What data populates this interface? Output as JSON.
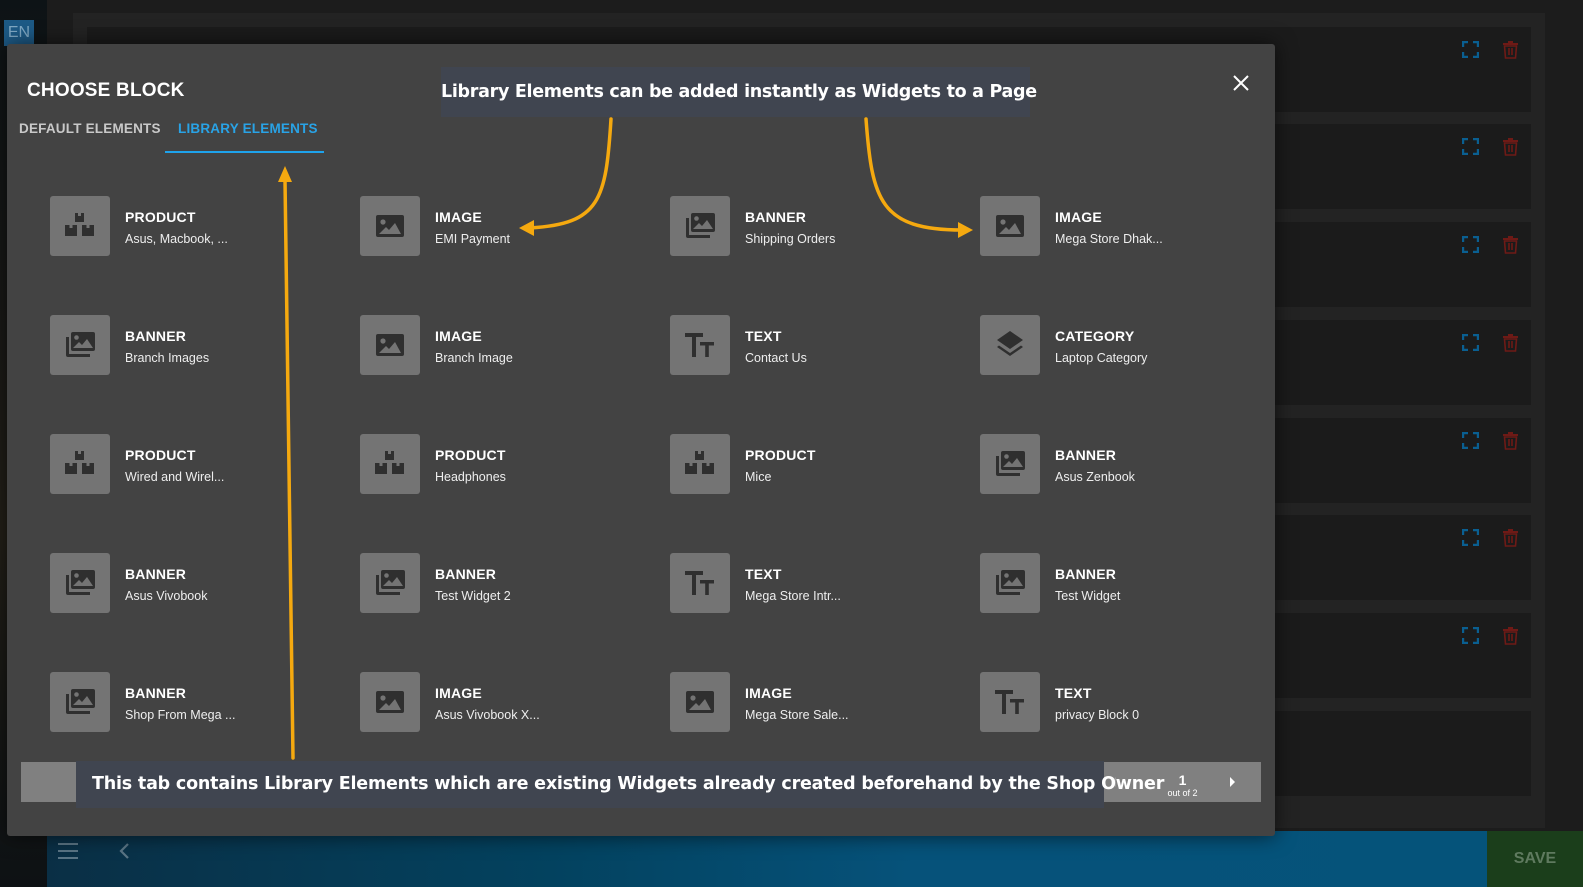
{
  "background": {
    "language_badge": "EN",
    "save_label": "SAVE",
    "row_count": 8
  },
  "modal": {
    "title": "CHOOSE BLOCK",
    "close_icon": "close-icon",
    "tabs": [
      {
        "label": "DEFAULT ELEMENTS",
        "active": false
      },
      {
        "label": "LIBRARY ELEMENTS",
        "active": true
      }
    ],
    "items": [
      {
        "type": "PRODUCT",
        "name": "Asus, Macbook, ...",
        "icon": "boxes-icon"
      },
      {
        "type": "IMAGE",
        "name": "EMI Payment",
        "icon": "image-icon"
      },
      {
        "type": "BANNER",
        "name": "Shipping Orders",
        "icon": "images-icon"
      },
      {
        "type": "IMAGE",
        "name": "Mega Store Dhak...",
        "icon": "image-icon"
      },
      {
        "type": "BANNER",
        "name": "Branch Images",
        "icon": "images-icon"
      },
      {
        "type": "IMAGE",
        "name": "Branch Image",
        "icon": "image-icon"
      },
      {
        "type": "TEXT",
        "name": "Contact Us",
        "icon": "text-icon"
      },
      {
        "type": "CATEGORY",
        "name": "Laptop Category",
        "icon": "layers-icon"
      },
      {
        "type": "PRODUCT",
        "name": "Wired and Wirel...",
        "icon": "boxes-icon"
      },
      {
        "type": "PRODUCT",
        "name": "Headphones",
        "icon": "boxes-icon"
      },
      {
        "type": "PRODUCT",
        "name": "Mice",
        "icon": "boxes-icon"
      },
      {
        "type": "BANNER",
        "name": "Asus Zenbook",
        "icon": "images-icon"
      },
      {
        "type": "BANNER",
        "name": "Asus Vivobook",
        "icon": "images-icon"
      },
      {
        "type": "BANNER",
        "name": "Test Widget 2",
        "icon": "images-icon"
      },
      {
        "type": "TEXT",
        "name": "Mega Store Intr...",
        "icon": "text-icon"
      },
      {
        "type": "BANNER",
        "name": "Test Widget",
        "icon": "images-icon"
      },
      {
        "type": "BANNER",
        "name": "Shop From Mega ...",
        "icon": "images-icon"
      },
      {
        "type": "IMAGE",
        "name": "Asus Vivobook X...",
        "icon": "image-icon"
      },
      {
        "type": "IMAGE",
        "name": "Mega Store Sale...",
        "icon": "image-icon"
      },
      {
        "type": "TEXT",
        "name": "privacy Block 0",
        "icon": "text-icon"
      }
    ],
    "pagination": {
      "current_page": "1",
      "total_label": "out of 2"
    }
  },
  "annotations": {
    "top_callout": "Library Elements can be added instantly as Widgets to a Page",
    "bottom_callout": "This tab contains Library Elements which are existing Widgets already created beforehand by the Shop Owner",
    "arrow_color": "#f5a90f"
  },
  "colors": {
    "accent": "#1ea3ec",
    "modal_bg": "#434343",
    "icon_tile": "#747474",
    "callout_bg": "#404550",
    "expand_icon": "#0a5f91",
    "trash_icon": "#6e1a16",
    "save_bg": "#1b3e1b"
  }
}
